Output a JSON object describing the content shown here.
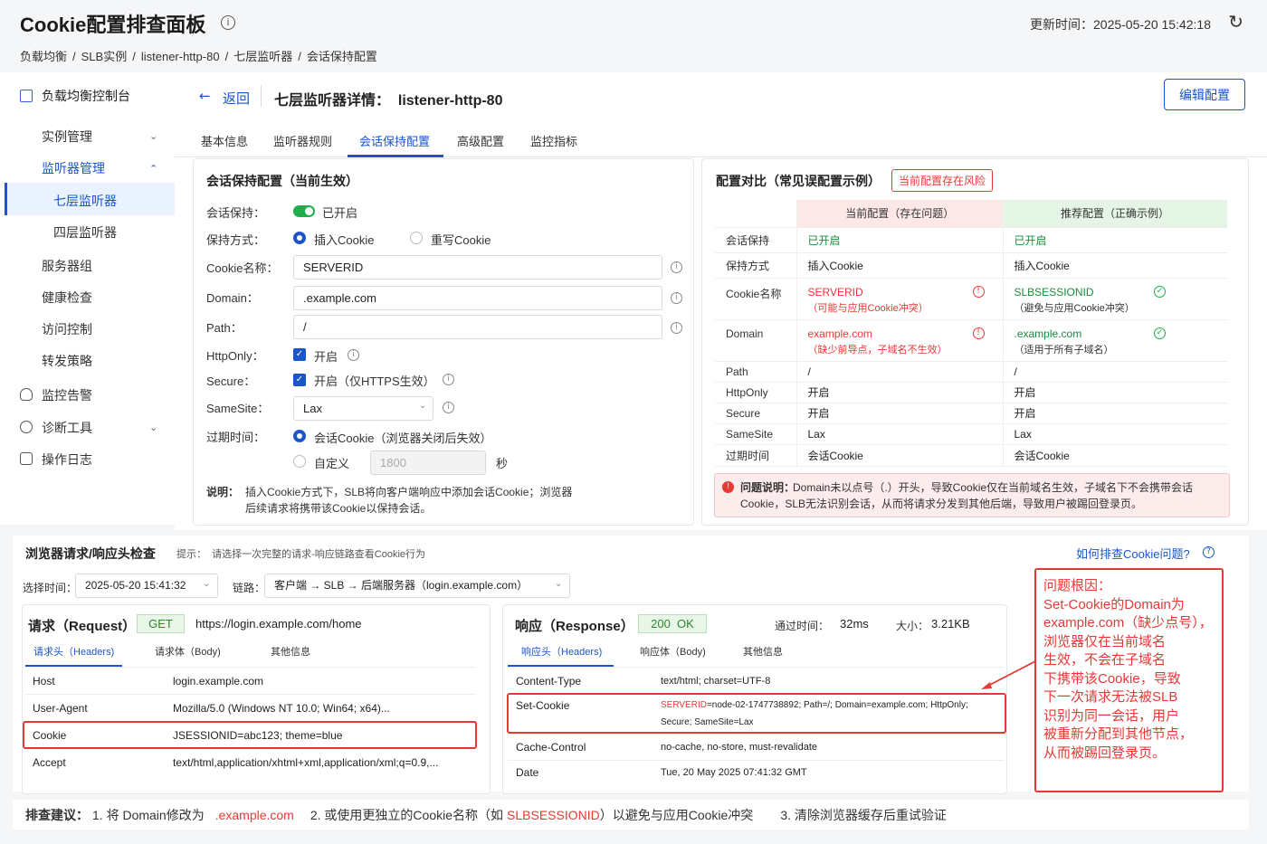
{
  "page_title": "Cookie配置排查面板",
  "update_time": "更新时间：2025-05-20 15:42:18",
  "breadcrumb": [
    "负载均衡",
    "/",
    "SLB实例",
    "/",
    "listener-http-80",
    "/",
    "七层监听器",
    "/",
    "会话保持配置"
  ],
  "sidebar": {
    "console": "负载均衡控制台",
    "items": [
      "实例管理",
      "监听器管理",
      "七层监听器",
      "四层监听器",
      "服务器组",
      "健康检查",
      "访问控制",
      "转发策略",
      "监控告警",
      "诊断工具",
      "操作日志"
    ]
  },
  "header": {
    "back": "返回",
    "title": "七层监听器详情：  listener-http-80",
    "edit": "编辑配置"
  },
  "tabs": [
    "基本信息",
    "监听器规则",
    "会话保持配置",
    "高级配置",
    "监控指标"
  ],
  "session": {
    "title": "会话保持配置（当前生效）",
    "labels": [
      "会话保持：",
      "保持方式：",
      "Cookie名称：",
      "Domain：",
      "Path：",
      "HttpOnly：",
      "Secure：",
      "SameSite：",
      "过期时间："
    ],
    "enabled": "已开启",
    "mode_insert": "插入Cookie",
    "mode_rewrite": "重写Cookie",
    "cookie_name": "SERVERID",
    "domain": ".example.com",
    "path": "/",
    "httponly": "开启",
    "secure": "开启（仅HTTPS生效）",
    "samesite": "Lax",
    "expire_session": "会话Cookie（浏览器关闭后失效）",
    "expire_custom": "自定义",
    "expire_value": "1800",
    "expire_unit": "秒",
    "note_label": "说明：",
    "note_line1": "插入Cookie方式下，SLB将向客户端响应中添加会话Cookie；浏览器",
    "note_line2": "后续请求将携带该Cookie以保持会话。"
  },
  "compare": {
    "title": "配置对比（常见误配置示例）",
    "risk": "当前配置存在风险",
    "head_current": "当前配置（存在问题）",
    "head_recommended": "推荐配置（正确示例）",
    "rows": [
      {
        "k": "会话保持",
        "c": "已开启",
        "r": "已开启"
      },
      {
        "k": "保持方式",
        "c": "插入Cookie",
        "r": "插入Cookie"
      },
      {
        "k": "Cookie名称",
        "c": "SERVERID",
        "c_sub": "（可能与应用Cookie冲突）",
        "r": "SLBSESSIONID",
        "r_sub": "（避免与应用Cookie冲突）"
      },
      {
        "k": "Domain",
        "c": "example.com",
        "c_sub": "（缺少前导点，子域名不生效）",
        "r": ".example.com",
        "r_sub": "（适用于所有子域名）"
      },
      {
        "k": "Path",
        "c": "/",
        "r": "/"
      },
      {
        "k": "HttpOnly",
        "c": "开启",
        "r": "开启"
      },
      {
        "k": "Secure",
        "c": "开启",
        "r": "开启"
      },
      {
        "k": "SameSite",
        "c": "Lax",
        "r": "Lax"
      },
      {
        "k": "过期时间",
        "c": "会话Cookie",
        "r": "会话Cookie"
      }
    ],
    "problem_label": "问题说明：",
    "problem_line1": "Domain未以点号（.）开头，导致Cookie仅在当前域名生效，子域名下不会携带会话",
    "problem_line2": "Cookie，SLB无法识别会话，从而将请求分发到其他后端，导致用户被踢回登录页。"
  },
  "inspect": {
    "title": "浏览器请求/响应头检查",
    "hint": "提示：  请选择一次完整的请求-响应链路查看Cookie行为",
    "help": "如何排查Cookie问题?",
    "time_label": "选择时间：",
    "time_value": "2025-05-20 15:41:32",
    "chain_label": "链路：",
    "chain_value": "客户端 → SLB → 后端服务器（login.example.com）"
  },
  "request": {
    "title": "请求（Request）",
    "method": "GET",
    "url": "https://login.example.com/home",
    "tabs": [
      "请求头（Headers)",
      "请求体（Body)",
      "其他信息"
    ],
    "rows": [
      {
        "k": "Host",
        "v": "login.example.com"
      },
      {
        "k": "User-Agent",
        "v": "Mozilla/5.0 (Windows NT 10.0; Win64; x64)..."
      },
      {
        "k": "Cookie",
        "v": "JSESSIONID=abc123; theme=blue"
      },
      {
        "k": "Accept",
        "v": "text/html,application/xhtml+xml,application/xml;q=0.9,..."
      }
    ]
  },
  "response": {
    "title": "响应（Response）",
    "status": "200  OK",
    "time_label": "通过时间：",
    "time_value": "32ms",
    "size_label": "大小：",
    "size_value": "3.21KB",
    "tabs": [
      "响应头（Headers)",
      "响应体（Body)",
      "其他信息"
    ],
    "rows": [
      {
        "k": "Content-Type",
        "v": "text/html; charset=UTF-8"
      },
      {
        "k": "Set-Cookie",
        "v_red": "SERVERID",
        "v_line1": "=node-02-1747738892; Path=/; Domain=example.com; HttpOnly;",
        "v_line2": "Secure; SameSite=Lax"
      },
      {
        "k": "Cache-Control",
        "v": "no-cache, no-store, must-revalidate"
      },
      {
        "k": "Date",
        "v": "Tue, 20 May 2025 07:41:32 GMT"
      }
    ]
  },
  "root_cause": [
    "问题根因：",
    "Set-Cookie的Domain为",
    "example.com（缺少点号），",
    "浏览器仅在当前域名",
    "生效，不会在子域名",
    "下携带该Cookie，导致",
    "下一次请求无法被SLB",
    "识别为同一会话，用户",
    "被重新分配到其他节点，",
    "从而被踢回登录页。"
  ],
  "suggestion": {
    "label": "排查建议：",
    "s1": "1. 将 Domain修改为",
    "s1_red": ".example.com",
    "s2": "2. 或使用更独立的Cookie名称（如",
    "s2_red": "SLBSESSIONID",
    "s2_end": "）以避免与应用Cookie冲突",
    "s3": "3. 清除浏览器缓存后重试验证"
  },
  "colors": {
    "accent": "#1a55c9",
    "danger": "#e53935",
    "success": "#1fae4b"
  }
}
